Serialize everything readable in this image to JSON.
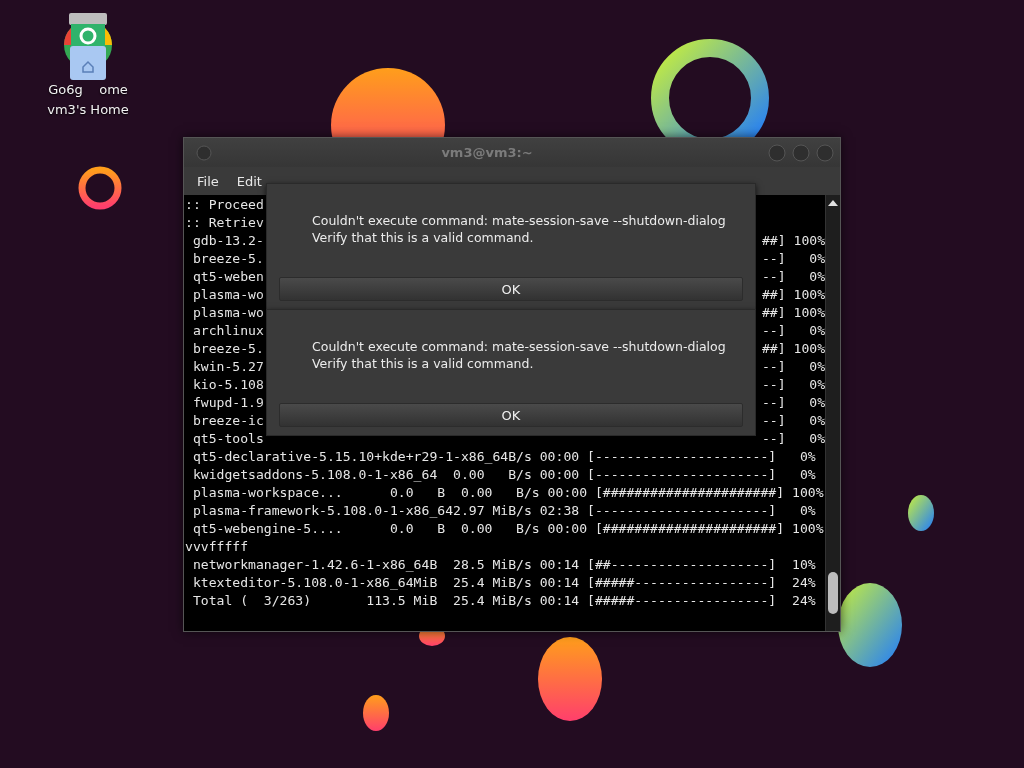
{
  "desktop_icons": {
    "labels": [
      "Go6g    ome",
      "vm3's Home"
    ]
  },
  "window": {
    "title": "vm3@vm3:~",
    "menu": [
      "File",
      "Edit"
    ]
  },
  "terminal": {
    "lines": [
      {
        "text": ":: Proceed"
      },
      {
        "text": ":: Retriev"
      },
      {
        "text": " gdb-13.2-",
        "tail": "##] 100%"
      },
      {
        "text": " breeze-5.",
        "tail": "--]   0%"
      },
      {
        "text": " qt5-weben",
        "tail": "--]   0%"
      },
      {
        "text": " plasma-wo",
        "tail": "##] 100%"
      },
      {
        "text": " plasma-wo",
        "tail": "##] 100%"
      },
      {
        "text": " archlinux",
        "tail": "--]   0%"
      },
      {
        "text": " breeze-5.",
        "tail": "##] 100%"
      },
      {
        "text": " kwin-5.27",
        "tail": "--]   0%"
      },
      {
        "text": " kio-5.108",
        "tail": "--]   0%"
      },
      {
        "text": " fwupd-1.9",
        "tail": "--]   0%"
      },
      {
        "text": " breeze-ic",
        "tail": "--]   0%"
      },
      {
        "text": " qt5-tools",
        "tail": "--]   0%"
      },
      {
        "text": " qt5-declarative-5.15.10+kde+r29-1-x86_64B/s 00:00 [----------------------]   0%"
      },
      {
        "text": " kwidgetsaddons-5.108.0-1-x86_64  0.00   B/s 00:00 [----------------------]   0%"
      },
      {
        "text": " plasma-workspace...      0.0   B  0.00   B/s 00:00 [######################] 100%"
      },
      {
        "text": " plasma-framework-5.108.0-1-x86_642.97 MiB/s 02:38 [----------------------]   0%"
      },
      {
        "text": " qt5-webengine-5....      0.0   B  0.00   B/s 00:00 [######################] 100%"
      },
      {
        "text": "vvvfffff"
      },
      {
        "text": " networkmanager-1.42.6-1-x86_64B  28.5 MiB/s 00:14 [##--------------------]  10%"
      },
      {
        "text": " ktexteditor-5.108.0-1-x86_64MiB  25.4 MiB/s 00:14 [#####-----------------]  24%"
      },
      {
        "text": " Total (  3/263)       113.5 MiB  25.4 MiB/s 00:14 [#####-----------------]  24%"
      }
    ]
  },
  "dialogs": [
    {
      "message": [
        "Couldn't execute command: mate-session-save --shutdown-dialog",
        "Verify that this is a valid command."
      ],
      "button": "OK"
    },
    {
      "message": [
        "Couldn't execute command: mate-session-save --shutdown-dialog",
        "Verify that this is a valid command."
      ],
      "button": "OK"
    }
  ]
}
